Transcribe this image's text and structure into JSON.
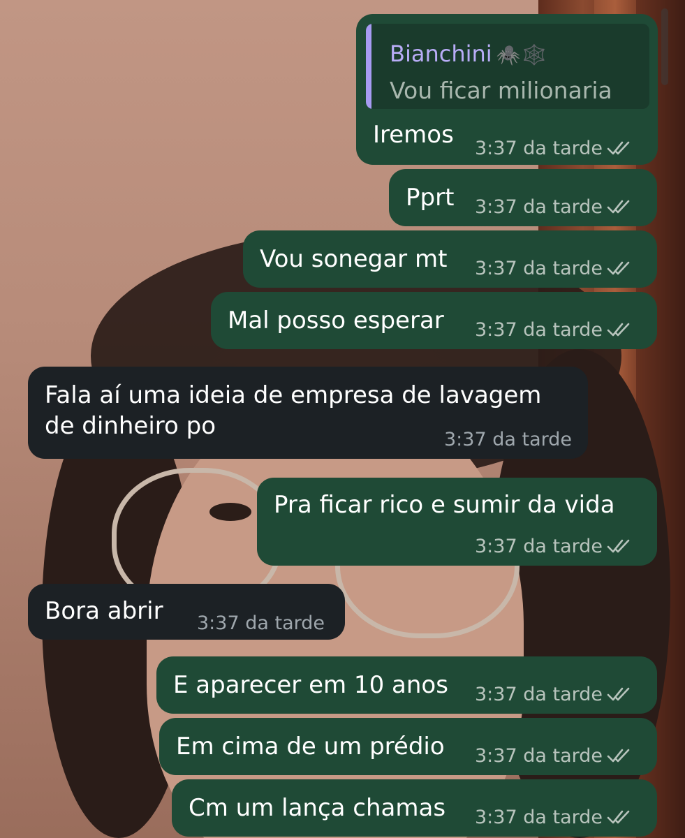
{
  "colors": {
    "outgoing_bubble": "#1f4a36",
    "incoming_bubble": "#1c2125",
    "reply_accent": "#a79bf2",
    "meta_text": "#b8c4bd"
  },
  "messages": [
    {
      "reply": {
        "author": "Bianchini",
        "author_emoji": "🕷️🕸️",
        "text": "Vou ficar milionaria"
      },
      "text": "Iremos",
      "time": "3:37 da tarde",
      "status_icon": "double-check-icon",
      "direction": "outgoing"
    },
    {
      "text": "Pprt",
      "time": "3:37 da tarde",
      "status_icon": "double-check-icon",
      "direction": "outgoing"
    },
    {
      "text": "Vou sonegar mt",
      "time": "3:37 da tarde",
      "status_icon": "double-check-icon",
      "direction": "outgoing"
    },
    {
      "text": "Mal posso esperar",
      "time": "3:37 da tarde",
      "status_icon": "double-check-icon",
      "direction": "outgoing"
    },
    {
      "text_lines": [
        "Fala aí uma ideia de empresa de lavagem",
        "de dinheiro po"
      ],
      "time": "3:37 da tarde",
      "direction": "incoming"
    },
    {
      "text": "Pra ficar rico e sumir da vida",
      "time": "3:37 da tarde",
      "status_icon": "double-check-icon",
      "direction": "outgoing"
    },
    {
      "text": "Bora abrir",
      "time": "3:37 da tarde",
      "direction": "incoming"
    },
    {
      "text": "E aparecer em 10 anos",
      "time": "3:37 da tarde",
      "status_icon": "double-check-icon",
      "direction": "outgoing"
    },
    {
      "text": "Em cima de um prédio",
      "time": "3:37 da tarde",
      "status_icon": "double-check-icon",
      "direction": "outgoing"
    },
    {
      "text": "Cm um lança chamas",
      "time": "3:37 da tarde",
      "status_icon": "double-check-icon",
      "direction": "outgoing"
    }
  ]
}
